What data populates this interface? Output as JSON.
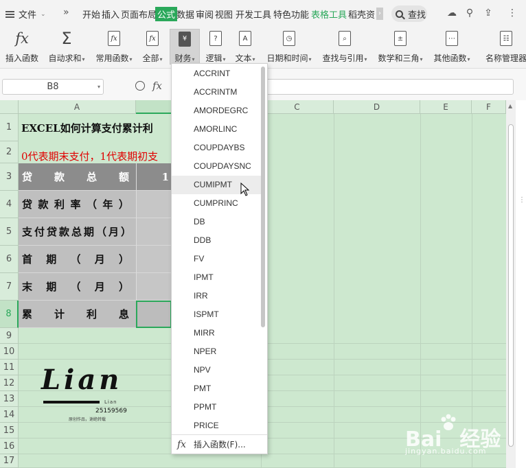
{
  "tabbar": {
    "file_label": "文件",
    "tabs": [
      {
        "label": "开始"
      },
      {
        "label": "插入"
      },
      {
        "label": "页面布局"
      },
      {
        "label": "公式",
        "active": true
      },
      {
        "label": "数据"
      },
      {
        "label": "审阅"
      },
      {
        "label": "视图"
      },
      {
        "label": "开发工具"
      },
      {
        "label": "特色功能"
      },
      {
        "label": "表格工具",
        "accent": true
      },
      {
        "label": "稻壳资"
      }
    ],
    "search_label": "查找",
    "accent_color": "#2aa85a"
  },
  "ribbon": {
    "buttons": [
      {
        "label": "插入函数",
        "icon": "fx-icon"
      },
      {
        "label": "自动求和",
        "icon": "sigma-icon",
        "dropdown": true
      },
      {
        "label": "常用函数",
        "icon": "star-function-icon",
        "dropdown": true
      },
      {
        "label": "全部",
        "icon": "all-functions-icon",
        "dropdown": true
      },
      {
        "label": "财务",
        "icon": "finance-icon",
        "dropdown": true,
        "pressed": true
      },
      {
        "label": "逻辑",
        "icon": "logic-icon",
        "dropdown": true
      },
      {
        "label": "文本",
        "icon": "text-icon",
        "dropdown": true
      },
      {
        "label": "日期和时间",
        "icon": "clock-icon",
        "dropdown": true
      },
      {
        "label": "查找与引用",
        "icon": "lookup-icon",
        "dropdown": true
      },
      {
        "label": "数学和三角",
        "icon": "math-icon",
        "dropdown": true
      },
      {
        "label": "其他函数",
        "icon": "other-functions-icon",
        "dropdown": true
      },
      {
        "label": "名称管理器",
        "icon": "name-manager-icon"
      }
    ]
  },
  "formula_bar": {
    "name_box": "B8",
    "fx_label": "fx",
    "value": ""
  },
  "sheet": {
    "columns": [
      "A",
      "",
      "C",
      "D",
      "E",
      "F"
    ],
    "rows": [
      "1",
      "2",
      "3",
      "4",
      "5",
      "6",
      "7",
      "8",
      "9",
      "10",
      "11",
      "12",
      "13",
      "14",
      "15",
      "16",
      "17"
    ],
    "row1_title": "EXCEL如何计算支付累计利",
    "row2_note": "0代表期末支付，1代表期初支",
    "labels": {
      "r3": [
        "贷",
        "款",
        "总",
        "额"
      ],
      "r4": [
        "贷",
        "款",
        "利",
        "率",
        "（",
        "年",
        "）"
      ],
      "r5": [
        "支付贷款总期（月）"
      ],
      "r6": [
        "首",
        "期",
        "（",
        "月",
        "）"
      ],
      "r7": [
        "末",
        "期",
        "（",
        "月",
        "）"
      ],
      "r8": [
        "累",
        "计",
        "利",
        "息"
      ]
    },
    "r3_value_fragment": "1"
  },
  "logo": {
    "word": "Lian",
    "small": "Lian",
    "number": "25159569",
    "caption": "原创作品，谢绝转载"
  },
  "dropdown": {
    "items": [
      "ACCRINT",
      "ACCRINTM",
      "AMORDEGRC",
      "AMORLINC",
      "COUPDAYBS",
      "COUPDAYSNC",
      "CUMIPMT",
      "CUMPRINC",
      "DB",
      "DDB",
      "FV",
      "IPMT",
      "IRR",
      "ISPMT",
      "MIRR",
      "NPER",
      "NPV",
      "PMT",
      "PPMT",
      "PRICE"
    ],
    "hovered": "CUMIPMT",
    "footer_label": "插入函数(F)...",
    "footer_icon": "fx-icon"
  },
  "watermark": {
    "brand": "Bai",
    "brand2": "经验",
    "url": "jingyan.baidu.com"
  }
}
